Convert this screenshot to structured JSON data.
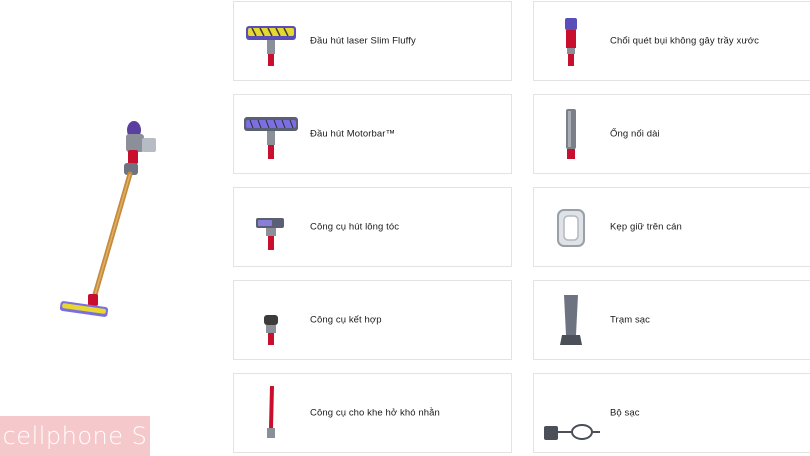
{
  "accessories_left": [
    {
      "label": "Đầu hút laser Slim Fluffy",
      "icon": "laser-slim-fluffy-head-icon"
    },
    {
      "label": "Đầu hút Motorbar™",
      "icon": "motorbar-head-icon"
    },
    {
      "label": "Công cụ hút lông tóc",
      "icon": "hair-screw-tool-icon"
    },
    {
      "label": "Công cụ kết hợp",
      "icon": "combination-tool-icon"
    },
    {
      "label": "Công cụ cho khe hở khó nhằn",
      "icon": "crevice-tool-icon"
    }
  ],
  "accessories_right": [
    {
      "label": "Chổi quét bụi không gây trầy xước",
      "icon": "dusting-brush-icon"
    },
    {
      "label": "Ống nối dài",
      "icon": "extension-wand-icon"
    },
    {
      "label": "Kẹp giữ trên cán",
      "icon": "wand-clip-icon"
    },
    {
      "label": "Trạm sạc",
      "icon": "docking-station-icon"
    },
    {
      "label": "Bộ sạc",
      "icon": "charger-icon"
    }
  ],
  "hero_image": "cordless-vacuum-icon",
  "watermark": {
    "text": "cellphone S"
  },
  "colors": {
    "accent_red": "#c8102e",
    "purple": "#5a3f9e",
    "gold": "#c58a3a",
    "border": "#e3e3e3"
  }
}
